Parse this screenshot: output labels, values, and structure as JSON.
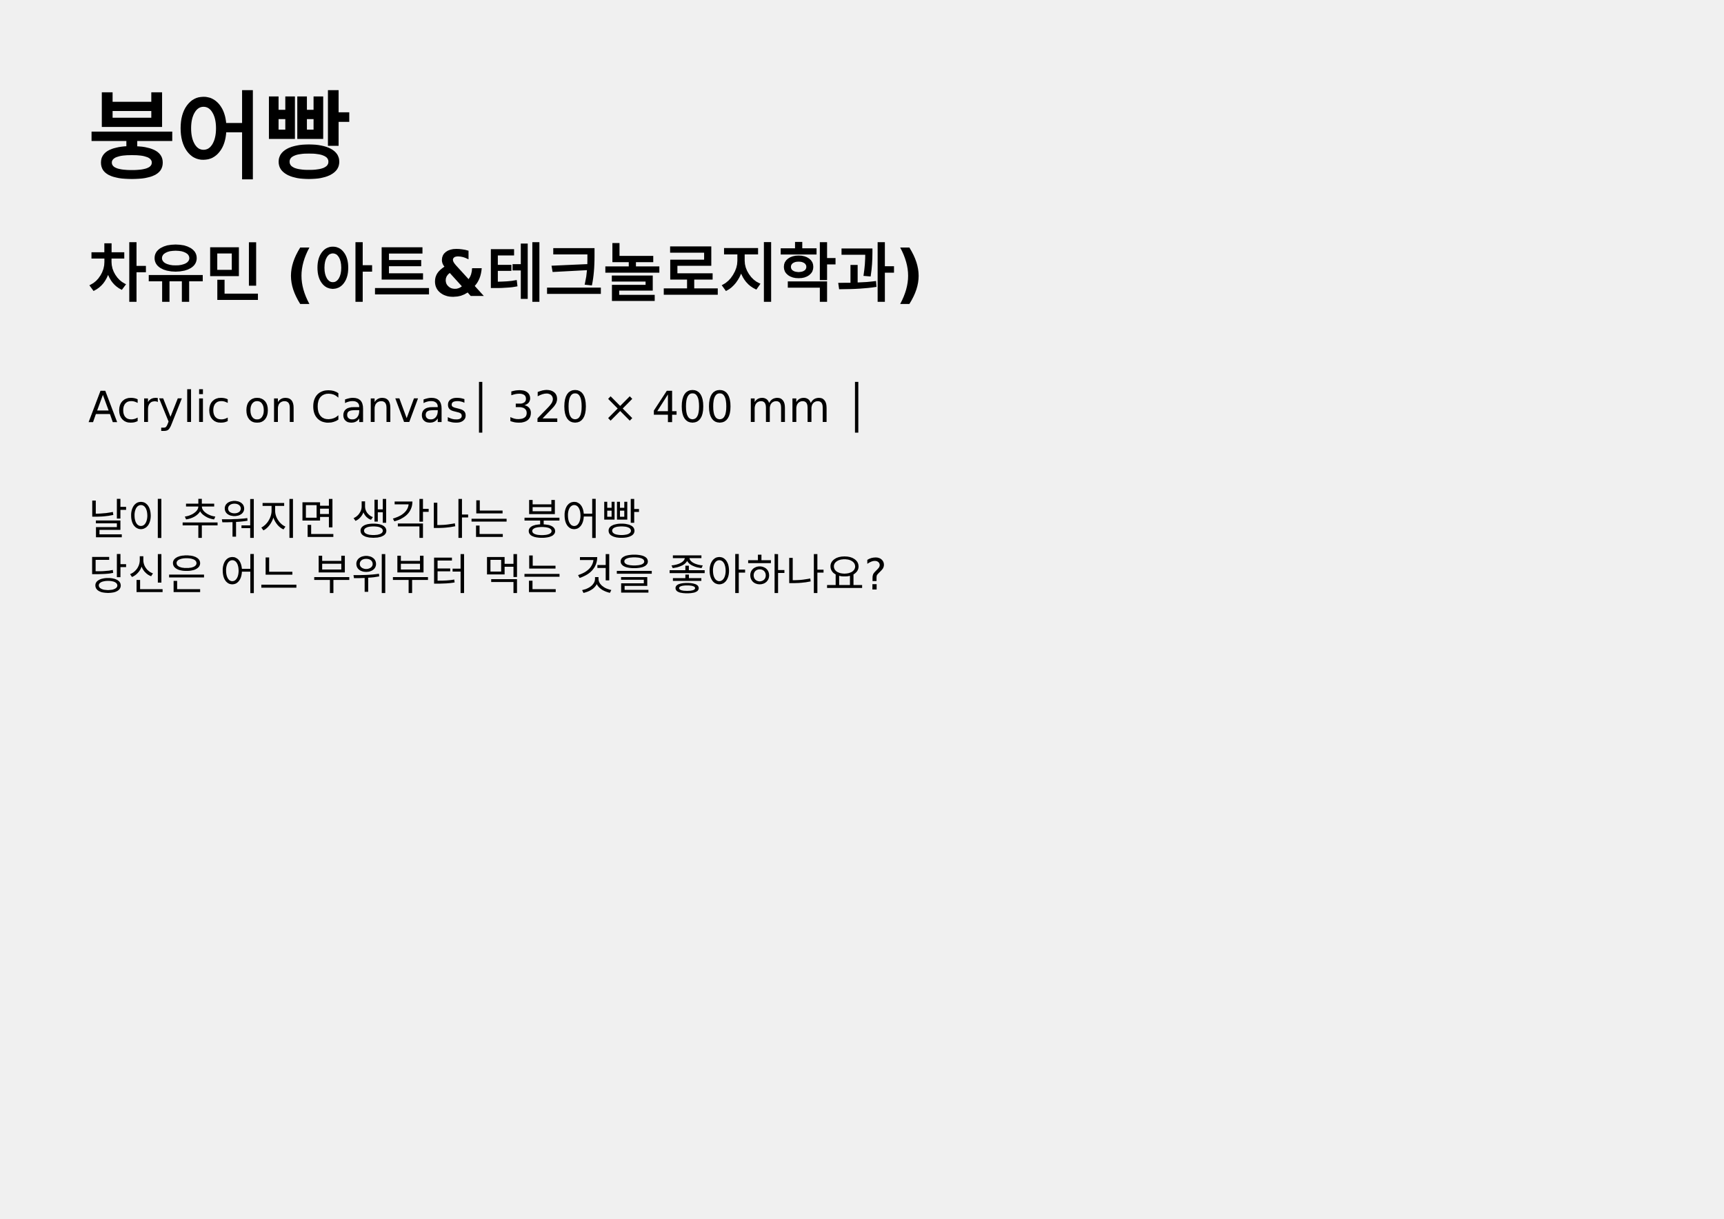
{
  "artwork": {
    "title": "붕어빵",
    "artist": "차유민 (아트&테크놀로지학과)",
    "medium_line": "Acrylic on Canvas│ 320 × 400 mm │",
    "description_lines": [
      "날이 추워지면 생각나는 붕어빵",
      "당신은 어느 부위부터 먹는 것을 좋아하나요?"
    ]
  },
  "colors": {
    "background": "#f0f0f0",
    "text": "#000000"
  }
}
